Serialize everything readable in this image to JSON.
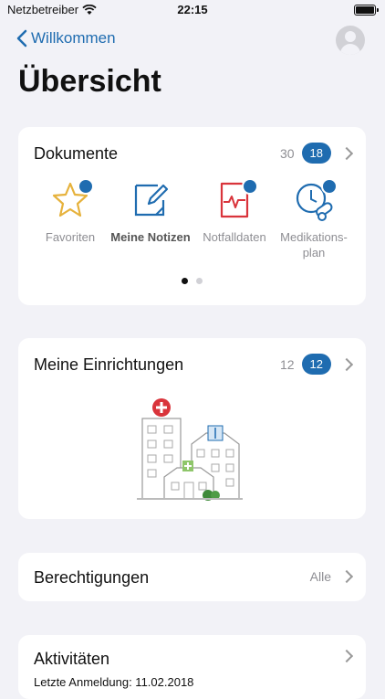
{
  "status": {
    "carrier": "Netzbetreiber",
    "time": "22:15"
  },
  "nav": {
    "back_label": "Willkommen"
  },
  "page_title": "Übersicht",
  "dokumente": {
    "title": "Dokumente",
    "count": "30",
    "badge": "18",
    "items": [
      {
        "label": "Favoriten"
      },
      {
        "label": "Meine Notizen"
      },
      {
        "label": "Notfalldaten"
      },
      {
        "label": "Medikations-plan"
      }
    ]
  },
  "einrichtungen": {
    "title": "Meine Einrichtungen",
    "count": "12",
    "badge": "12"
  },
  "berechtigungen": {
    "title": "Berechtigungen",
    "value": "Alle"
  },
  "aktivitaeten": {
    "title": "Aktivitäten",
    "last_login": "Letzte Anmeldung: 11.02.2018"
  },
  "colors": {
    "accent": "#1f6cb0",
    "background": "#f2f2f7",
    "emergency": "#d9343b",
    "star": "#e6b23c"
  }
}
